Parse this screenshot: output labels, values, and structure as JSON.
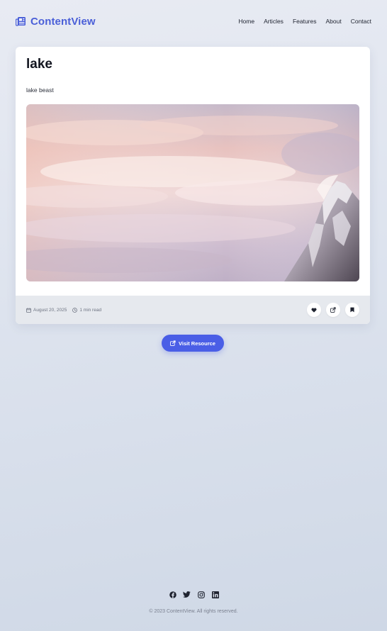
{
  "header": {
    "brand": "ContentView",
    "brand_icon": "newspaper-icon",
    "nav": [
      "Home",
      "Articles",
      "Features",
      "About",
      "Contact"
    ]
  },
  "card": {
    "title": "lake",
    "description": "lake beast",
    "image": "mountain-peak-sunset-clouds",
    "meta": {
      "date": "August 20, 2025",
      "date_icon": "calendar-icon",
      "read_time": "1 min read",
      "read_icon": "clock-icon"
    },
    "actions": [
      "heart-icon",
      "share-icon",
      "bookmark-icon"
    ]
  },
  "visit_button": {
    "label": "Visit Resource",
    "icon": "external-link-icon"
  },
  "footer": {
    "social": [
      "facebook-icon",
      "twitter-icon",
      "instagram-icon",
      "linkedin-icon"
    ],
    "copyright": "© 2023 ContentView. All rights reserved."
  },
  "colors": {
    "accent": "#4a5ee6",
    "brand": "#4a5fd8",
    "card_footer": "#e6e9ee"
  }
}
